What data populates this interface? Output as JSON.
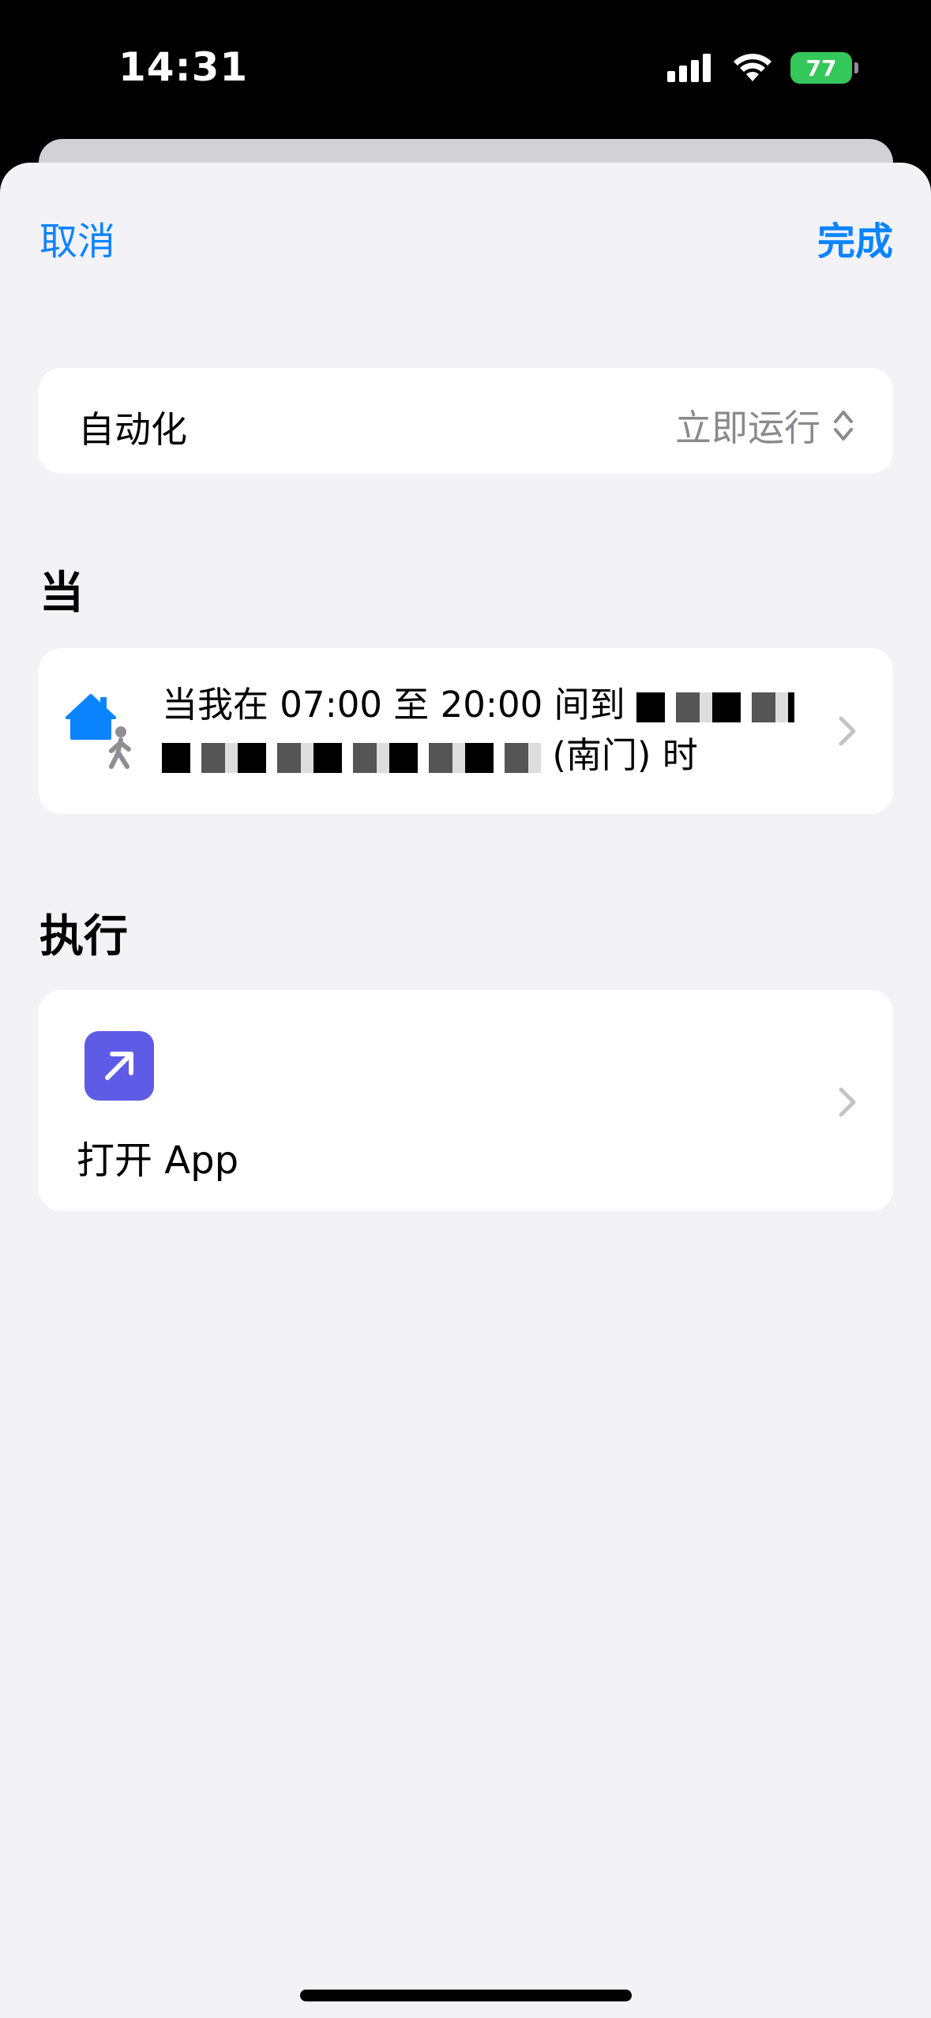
{
  "status_bar": {
    "time": "14:31",
    "battery": "77"
  },
  "nav": {
    "cancel_label": "取消",
    "done_label": "完成"
  },
  "automation_row": {
    "label": "自动化",
    "value": "立即运行"
  },
  "when_section": {
    "title": "当",
    "trigger_text_before": "当我在 07:00 至 20:00 间到",
    "trigger_text_after": "(南门) 时"
  },
  "do_section": {
    "title": "执行",
    "action_label": "打开 App"
  },
  "colors": {
    "accent": "#0a84ff",
    "battery": "#34c759",
    "app_icon": "#5e5ce6",
    "background": "#f2f2f7"
  }
}
